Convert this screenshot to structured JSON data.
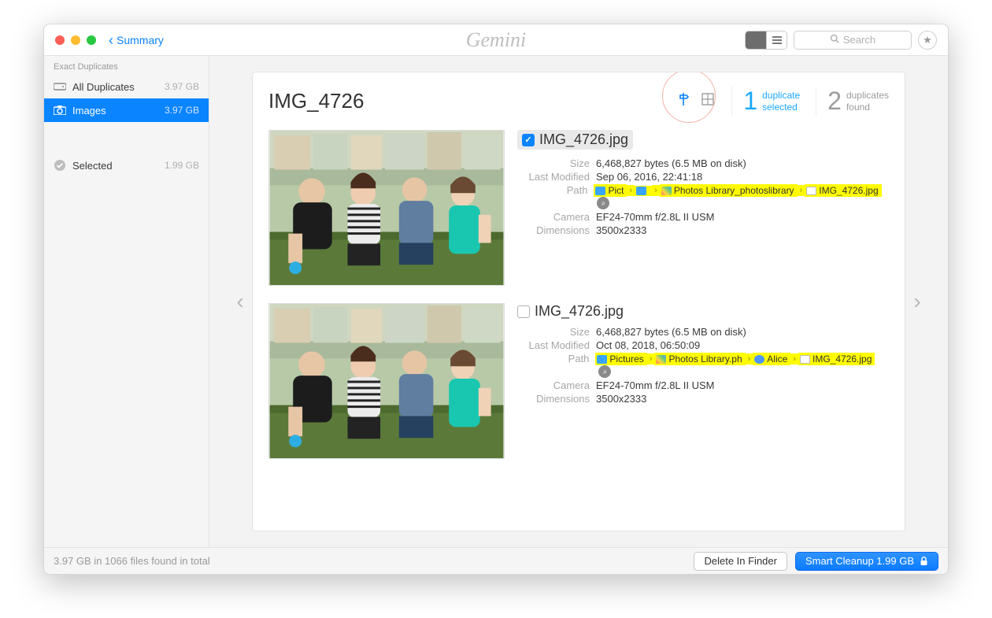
{
  "titlebar": {
    "back_label": "Summary",
    "brand": "Gemini",
    "search_placeholder": "Search"
  },
  "sidebar": {
    "section_label": "Exact Duplicates",
    "items": [
      {
        "label": "All Duplicates",
        "size": "3.97 GB"
      },
      {
        "label": "Images",
        "size": "3.97 GB"
      }
    ],
    "selected": {
      "label": "Selected",
      "size": "1.99 GB"
    }
  },
  "panel": {
    "title": "IMG_4726",
    "counts": {
      "selected_n": "1",
      "selected_l1": "duplicate",
      "selected_l2": "selected",
      "found_n": "2",
      "found_l1": "duplicates",
      "found_l2": "found"
    },
    "labels": {
      "size": "Size",
      "modified": "Last Modified",
      "path": "Path",
      "camera": "Camera",
      "dimensions": "Dimensions"
    },
    "dup1": {
      "filename": "IMG_4726.jpg",
      "size": "6,468,827 bytes (6.5 MB on disk)",
      "modified": "Sep 06, 2016, 22:41:18",
      "camera": "EF24-70mm f/2.8L II USM",
      "dimensions": "3500x2333",
      "path": [
        "Pict",
        "",
        "Photos Library_photoslibrary",
        "IMG_4726.jpg"
      ]
    },
    "dup2": {
      "filename": "IMG_4726.jpg",
      "size": "6,468,827 bytes (6.5 MB on disk)",
      "modified": "Oct 08, 2018, 06:50:09",
      "camera": "EF24-70mm f/2.8L II USM",
      "dimensions": "3500x2333",
      "path": [
        "Pictures",
        "Photos Library.ph",
        "Alice",
        "IMG_4726.jpg"
      ]
    }
  },
  "statusbar": {
    "summary": "3.97 GB in 1066 files found in total",
    "delete_btn": "Delete In Finder",
    "cleanup_btn": "Smart Cleanup 1.99 GB"
  }
}
